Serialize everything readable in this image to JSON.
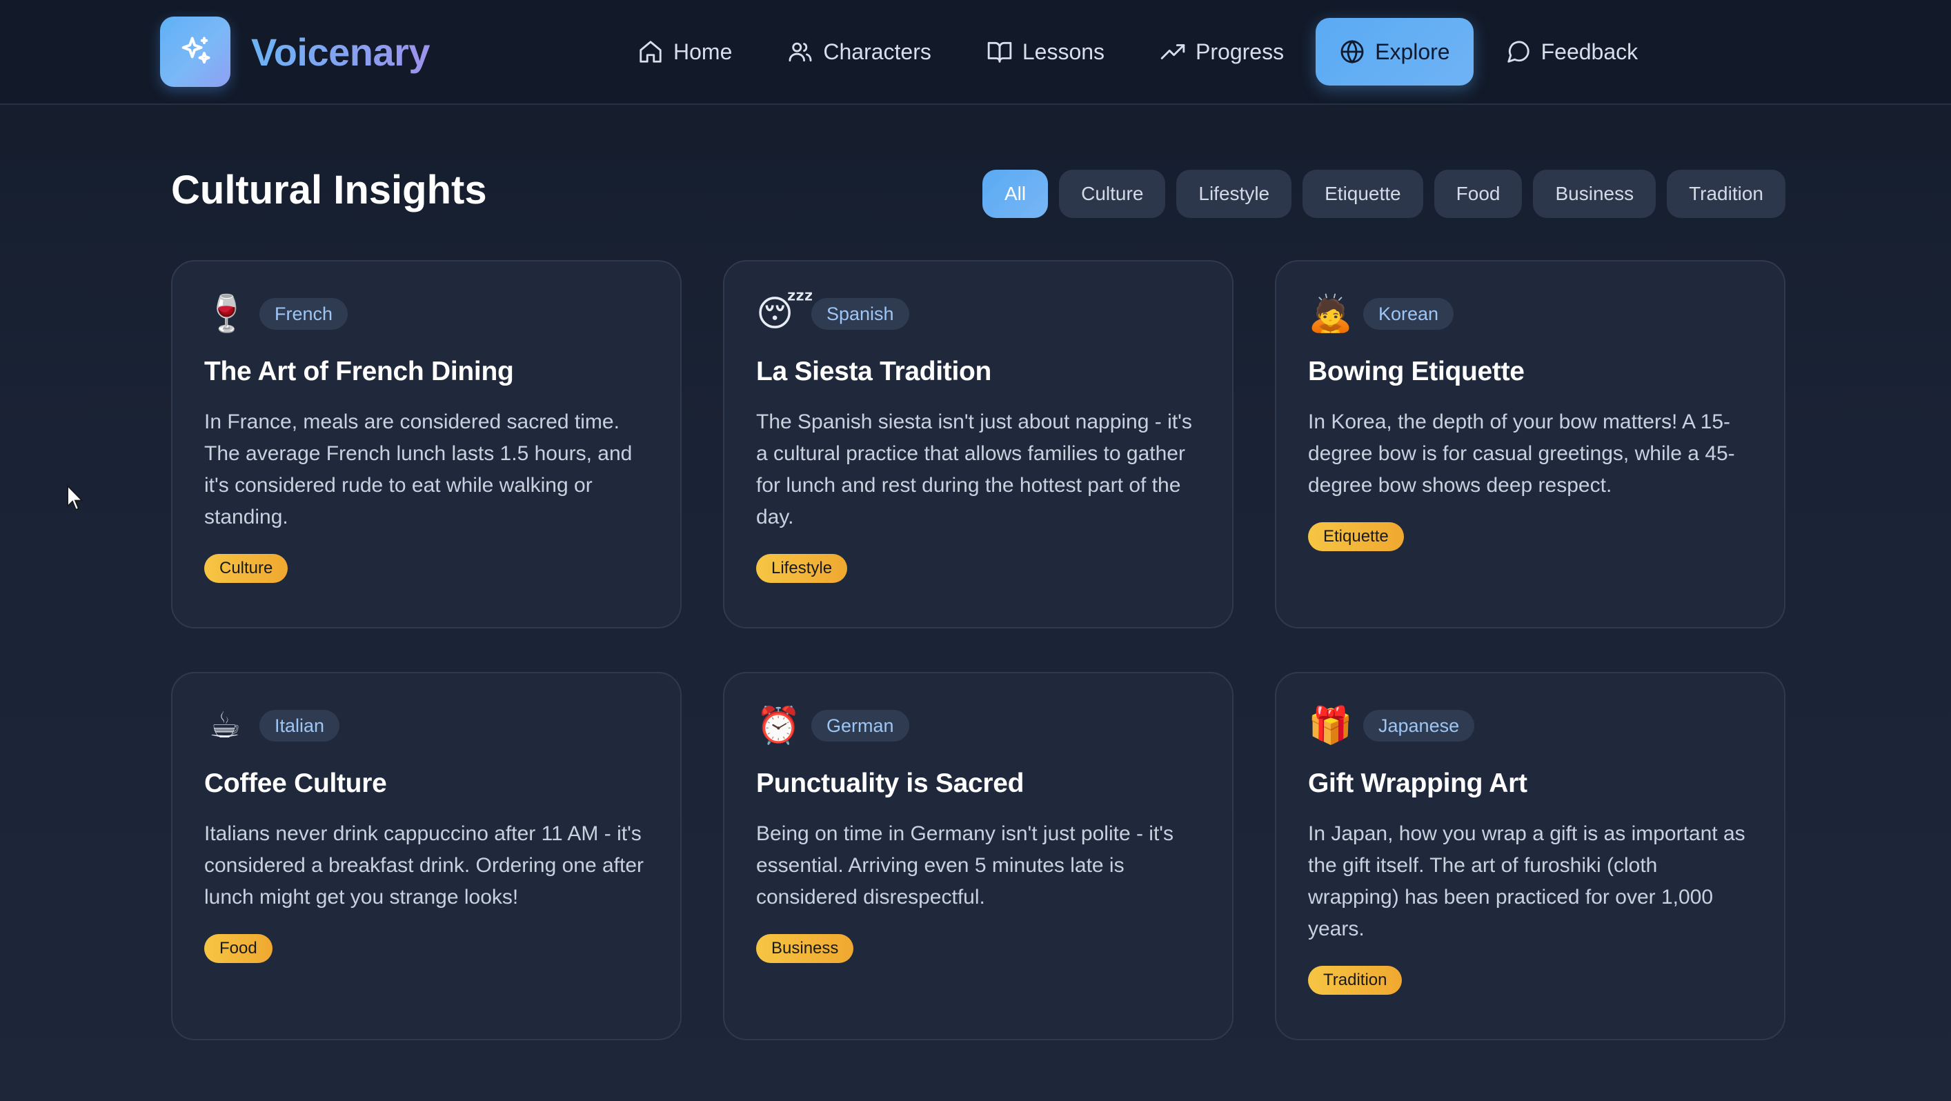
{
  "app": {
    "name": "Voicenary",
    "accent": "#5aaaf3",
    "tag_color": "#f6c544"
  },
  "nav": {
    "items": [
      {
        "label": "Home",
        "icon": "home-icon"
      },
      {
        "label": "Characters",
        "icon": "users-icon"
      },
      {
        "label": "Lessons",
        "icon": "book-open-icon"
      },
      {
        "label": "Progress",
        "icon": "trending-up-icon"
      },
      {
        "label": "Explore",
        "icon": "globe-icon",
        "active": true
      },
      {
        "label": "Feedback",
        "icon": "message-circle-icon"
      }
    ]
  },
  "page": {
    "title": "Cultural Insights"
  },
  "filters": {
    "items": [
      "All",
      "Culture",
      "Lifestyle",
      "Etiquette",
      "Food",
      "Business",
      "Tradition"
    ],
    "selected": "All"
  },
  "cards": [
    {
      "emoji": "🍷",
      "emoji_name": "wine-glass-icon",
      "language": "French",
      "title": "The Art of French Dining",
      "description": "In France, meals are considered sacred time. The average French lunch lasts 1.5 hours, and it's considered rude to eat while walking or standing.",
      "tag": "Culture"
    },
    {
      "emoji": "😴",
      "emoji_name": "sleeping-face-icon",
      "language": "Spanish",
      "title": "La Siesta Tradition",
      "description": "The Spanish siesta isn't just about napping - it's a cultural practice that allows families to gather for lunch and rest during the hottest part of the day.",
      "tag": "Lifestyle"
    },
    {
      "emoji": "🙇",
      "emoji_name": "bowing-person-icon",
      "language": "Korean",
      "title": "Bowing Etiquette",
      "description": "In Korea, the depth of your bow matters! A 15-degree bow is for casual greetings, while a 45-degree bow shows deep respect.",
      "tag": "Etiquette"
    },
    {
      "emoji": "☕",
      "emoji_name": "coffee-cup-icon",
      "language": "Italian",
      "title": "Coffee Culture",
      "description": "Italians never drink cappuccino after 11 AM - it's considered a breakfast drink. Ordering one after lunch might get you strange looks!",
      "tag": "Food"
    },
    {
      "emoji": "⏰",
      "emoji_name": "alarm-clock-icon",
      "language": "German",
      "title": "Punctuality is Sacred",
      "description": "Being on time in Germany isn't just polite - it's essential. Arriving even 5 minutes late is considered disrespectful.",
      "tag": "Business"
    },
    {
      "emoji": "🎁",
      "emoji_name": "gift-icon",
      "language": "Japanese",
      "title": "Gift Wrapping Art",
      "description": "In Japan, how you wrap a gift is as important as the gift itself. The art of furoshiki (cloth wrapping) has been practiced for over 1,000 years.",
      "tag": "Tradition"
    }
  ]
}
